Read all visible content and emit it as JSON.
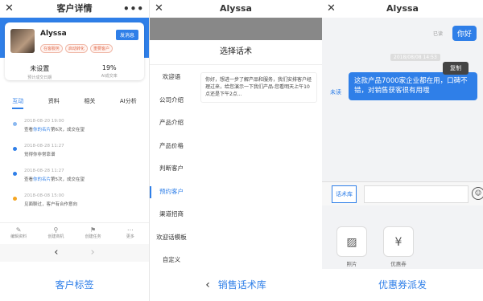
{
  "panel1": {
    "title": "客户详情",
    "back": "✕",
    "more": "•••",
    "customer": {
      "name": "Alyssa",
      "send_button": "发消息",
      "tags": [
        "在客服务",
        "启动转化",
        "重要客户"
      ],
      "stats": [
        {
          "value": "未设置",
          "label": "预计成交日期"
        },
        {
          "value": "19%",
          "label": "AI成交率"
        }
      ]
    },
    "tabs": [
      "互动",
      "资料",
      "相关",
      "AI分析"
    ],
    "events": [
      {
        "time": "2018-08-20 19:00",
        "text_pre": "查看",
        "text_link": "你的名片",
        "text_post": "第6次，成交在望",
        "color": "#8ab8f0"
      },
      {
        "time": "2018-08-28 11:27",
        "text_pre": "",
        "text_link": "",
        "text_post": "觉得你非常靠谱",
        "color": "#2f7fe8"
      },
      {
        "time": "2018-08-28 11:27",
        "text_pre": "查看",
        "text_link": "你的名片",
        "text_post": "第5次，成交在望",
        "color": "#2f7fe8"
      },
      {
        "time": "2018-08-08 15:00",
        "text_pre": "",
        "text_link": "",
        "text_post": "见面聊过，客户有合作意向",
        "color": "#f5a623"
      }
    ],
    "toolbar": [
      {
        "icon": "✎",
        "label": "编辑资料"
      },
      {
        "icon": "⚲",
        "label": "创建商机"
      },
      {
        "icon": "⚑",
        "label": "创建任务"
      },
      {
        "icon": "⋯",
        "label": "更多"
      }
    ],
    "nav_prev": "‹",
    "nav_next": "›",
    "caption": "客户标签"
  },
  "panel2": {
    "title": "Alyssa",
    "back": "✕",
    "sheet_title": "选择话术",
    "categories": [
      "欢迎语",
      "公司介绍",
      "产品介绍",
      "产品价格",
      "判断客户",
      "预约客户",
      "渠道招商",
      "欢迎话模板",
      "自定义"
    ],
    "active_category": 5,
    "script": "你好，想进一步了解产品和服务，我们安排客户经理过来，给您演示一下我们产品-您看明天上午10点还是下午2点...",
    "back_arrow": "‹",
    "caption": "销售话术库"
  },
  "panel3": {
    "title": "Alyssa",
    "back": "✕",
    "msg_me": "你好",
    "read_label": "已读",
    "date_badge": "2018/08/08 14:53",
    "copy_label": "复制",
    "big_message": "这款产品7000家企业都在用，口碑不错，对销售获客很有用哦",
    "unread_label": "未读",
    "script_lib_button": "话术库",
    "emoji_icon": "☺",
    "tools": [
      {
        "icon": "▨",
        "label": "照片"
      },
      {
        "icon": "¥",
        "label": "优惠券"
      }
    ],
    "caption": "优惠券派发"
  }
}
